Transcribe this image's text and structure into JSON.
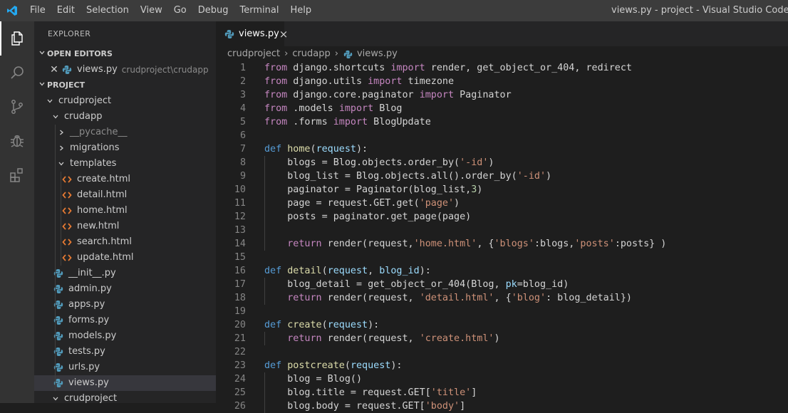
{
  "titlebar": {
    "logo": "vscode-logo-icon",
    "menu": [
      "File",
      "Edit",
      "Selection",
      "View",
      "Go",
      "Debug",
      "Terminal",
      "Help"
    ],
    "window_title": "views.py - project - Visual Studio Code"
  },
  "activitybar": {
    "icons": [
      "explorer-icon",
      "search-icon",
      "source-control-icon",
      "debug-icon",
      "extensions-icon"
    ]
  },
  "sidebar": {
    "title": "EXPLORER",
    "open_editors_header": "OPEN EDITORS",
    "open_editor": {
      "name": "views.py",
      "path": "crudproject\\crudapp"
    },
    "project_header": "PROJECT",
    "tree": [
      {
        "label": "crudproject",
        "type": "folder-open",
        "depth": 0
      },
      {
        "label": "crudapp",
        "type": "folder-open",
        "depth": 1
      },
      {
        "label": "__pycache__",
        "type": "folder-closed",
        "depth": 2,
        "dim": true
      },
      {
        "label": "migrations",
        "type": "folder-closed",
        "depth": 2
      },
      {
        "label": "templates",
        "type": "folder-open",
        "depth": 2
      },
      {
        "label": "create.html",
        "type": "html",
        "depth": 3
      },
      {
        "label": "detail.html",
        "type": "html",
        "depth": 3
      },
      {
        "label": "home.html",
        "type": "html",
        "depth": 3
      },
      {
        "label": "new.html",
        "type": "html",
        "depth": 3
      },
      {
        "label": "search.html",
        "type": "html",
        "depth": 3
      },
      {
        "label": "update.html",
        "type": "html",
        "depth": 3
      },
      {
        "label": "__init__.py",
        "type": "py",
        "depth": 2
      },
      {
        "label": "admin.py",
        "type": "py",
        "depth": 2
      },
      {
        "label": "apps.py",
        "type": "py",
        "depth": 2
      },
      {
        "label": "forms.py",
        "type": "py",
        "depth": 2
      },
      {
        "label": "models.py",
        "type": "py",
        "depth": 2
      },
      {
        "label": "tests.py",
        "type": "py",
        "depth": 2
      },
      {
        "label": "urls.py",
        "type": "py",
        "depth": 2
      },
      {
        "label": "views.py",
        "type": "py",
        "depth": 2,
        "selected": true
      },
      {
        "label": "crudproject",
        "type": "folder-open",
        "depth": 1
      }
    ]
  },
  "editor": {
    "tab": {
      "label": "views.py",
      "close": "×"
    },
    "breadcrumb": [
      "crudproject",
      "crudapp",
      "views.py"
    ],
    "lines": [
      [
        [
          "kw",
          "from"
        ],
        [
          "tx",
          " django.shortcuts "
        ],
        [
          "kw",
          "import"
        ],
        [
          "tx",
          " render, get_object_or_404, redirect"
        ]
      ],
      [
        [
          "kw",
          "from"
        ],
        [
          "tx",
          " django.utils "
        ],
        [
          "kw",
          "import"
        ],
        [
          "tx",
          " timezone"
        ]
      ],
      [
        [
          "kw",
          "from"
        ],
        [
          "tx",
          " django.core.paginator "
        ],
        [
          "kw",
          "import"
        ],
        [
          "tx",
          " Paginator"
        ]
      ],
      [
        [
          "kw",
          "from"
        ],
        [
          "tx",
          " .models "
        ],
        [
          "kw",
          "import"
        ],
        [
          "tx",
          " Blog"
        ]
      ],
      [
        [
          "kw",
          "from"
        ],
        [
          "tx",
          " .forms "
        ],
        [
          "kw",
          "import"
        ],
        [
          "tx",
          " BlogUpdate"
        ]
      ],
      [],
      [
        [
          "df",
          "def"
        ],
        [
          "tx",
          " "
        ],
        [
          "fn",
          "home"
        ],
        [
          "tx",
          "("
        ],
        [
          "pr",
          "request"
        ],
        [
          "tx",
          "):"
        ]
      ],
      [
        [
          "tx",
          "    blogs = Blog.objects.order_by("
        ],
        [
          "st",
          "'-id'"
        ],
        [
          "tx",
          ")"
        ]
      ],
      [
        [
          "tx",
          "    blog_list = Blog.objects.all().order_by("
        ],
        [
          "st",
          "'-id'"
        ],
        [
          "tx",
          ")"
        ]
      ],
      [
        [
          "tx",
          "    paginator = Paginator(blog_list,"
        ],
        [
          "nm",
          "3"
        ],
        [
          "tx",
          ")"
        ]
      ],
      [
        [
          "tx",
          "    page = request.GET.get("
        ],
        [
          "st",
          "'page'"
        ],
        [
          "tx",
          ")"
        ]
      ],
      [
        [
          "tx",
          "    posts = paginator.get_page(page)"
        ]
      ],
      [
        [
          "tx",
          "    "
        ]
      ],
      [
        [
          "tx",
          "    "
        ],
        [
          "kw",
          "return"
        ],
        [
          "tx",
          " render(request,"
        ],
        [
          "st",
          "'home.html'"
        ],
        [
          "tx",
          ", {"
        ],
        [
          "st",
          "'blogs'"
        ],
        [
          "tx",
          ":blogs,"
        ],
        [
          "st",
          "'posts'"
        ],
        [
          "tx",
          ":posts} )"
        ]
      ],
      [],
      [
        [
          "df",
          "def"
        ],
        [
          "tx",
          " "
        ],
        [
          "fn",
          "detail"
        ],
        [
          "tx",
          "("
        ],
        [
          "pr",
          "request"
        ],
        [
          "tx",
          ", "
        ],
        [
          "pr",
          "blog_id"
        ],
        [
          "tx",
          "):"
        ]
      ],
      [
        [
          "tx",
          "    blog_detail = get_object_or_404(Blog, "
        ],
        [
          "pr",
          "pk"
        ],
        [
          "tx",
          "=blog_id)"
        ]
      ],
      [
        [
          "tx",
          "    "
        ],
        [
          "kw",
          "return"
        ],
        [
          "tx",
          " render(request, "
        ],
        [
          "st",
          "'detail.html'"
        ],
        [
          "tx",
          ", {"
        ],
        [
          "st",
          "'blog'"
        ],
        [
          "tx",
          ": blog_detail})"
        ]
      ],
      [],
      [
        [
          "df",
          "def"
        ],
        [
          "tx",
          " "
        ],
        [
          "fn",
          "create"
        ],
        [
          "tx",
          "("
        ],
        [
          "pr",
          "request"
        ],
        [
          "tx",
          "):"
        ]
      ],
      [
        [
          "tx",
          "    "
        ],
        [
          "kw",
          "return"
        ],
        [
          "tx",
          " render(request, "
        ],
        [
          "st",
          "'create.html'"
        ],
        [
          "tx",
          ")"
        ]
      ],
      [],
      [
        [
          "df",
          "def"
        ],
        [
          "tx",
          " "
        ],
        [
          "fn",
          "postcreate"
        ],
        [
          "tx",
          "("
        ],
        [
          "pr",
          "request"
        ],
        [
          "tx",
          "):"
        ]
      ],
      [
        [
          "tx",
          "    blog = Blog()"
        ]
      ],
      [
        [
          "tx",
          "    blog.title = request.GET["
        ],
        [
          "st",
          "'title'"
        ],
        [
          "tx",
          "]"
        ]
      ],
      [
        [
          "tx",
          "    blog.body = request.GET["
        ],
        [
          "st",
          "'body'"
        ],
        [
          "tx",
          "]"
        ]
      ]
    ]
  }
}
